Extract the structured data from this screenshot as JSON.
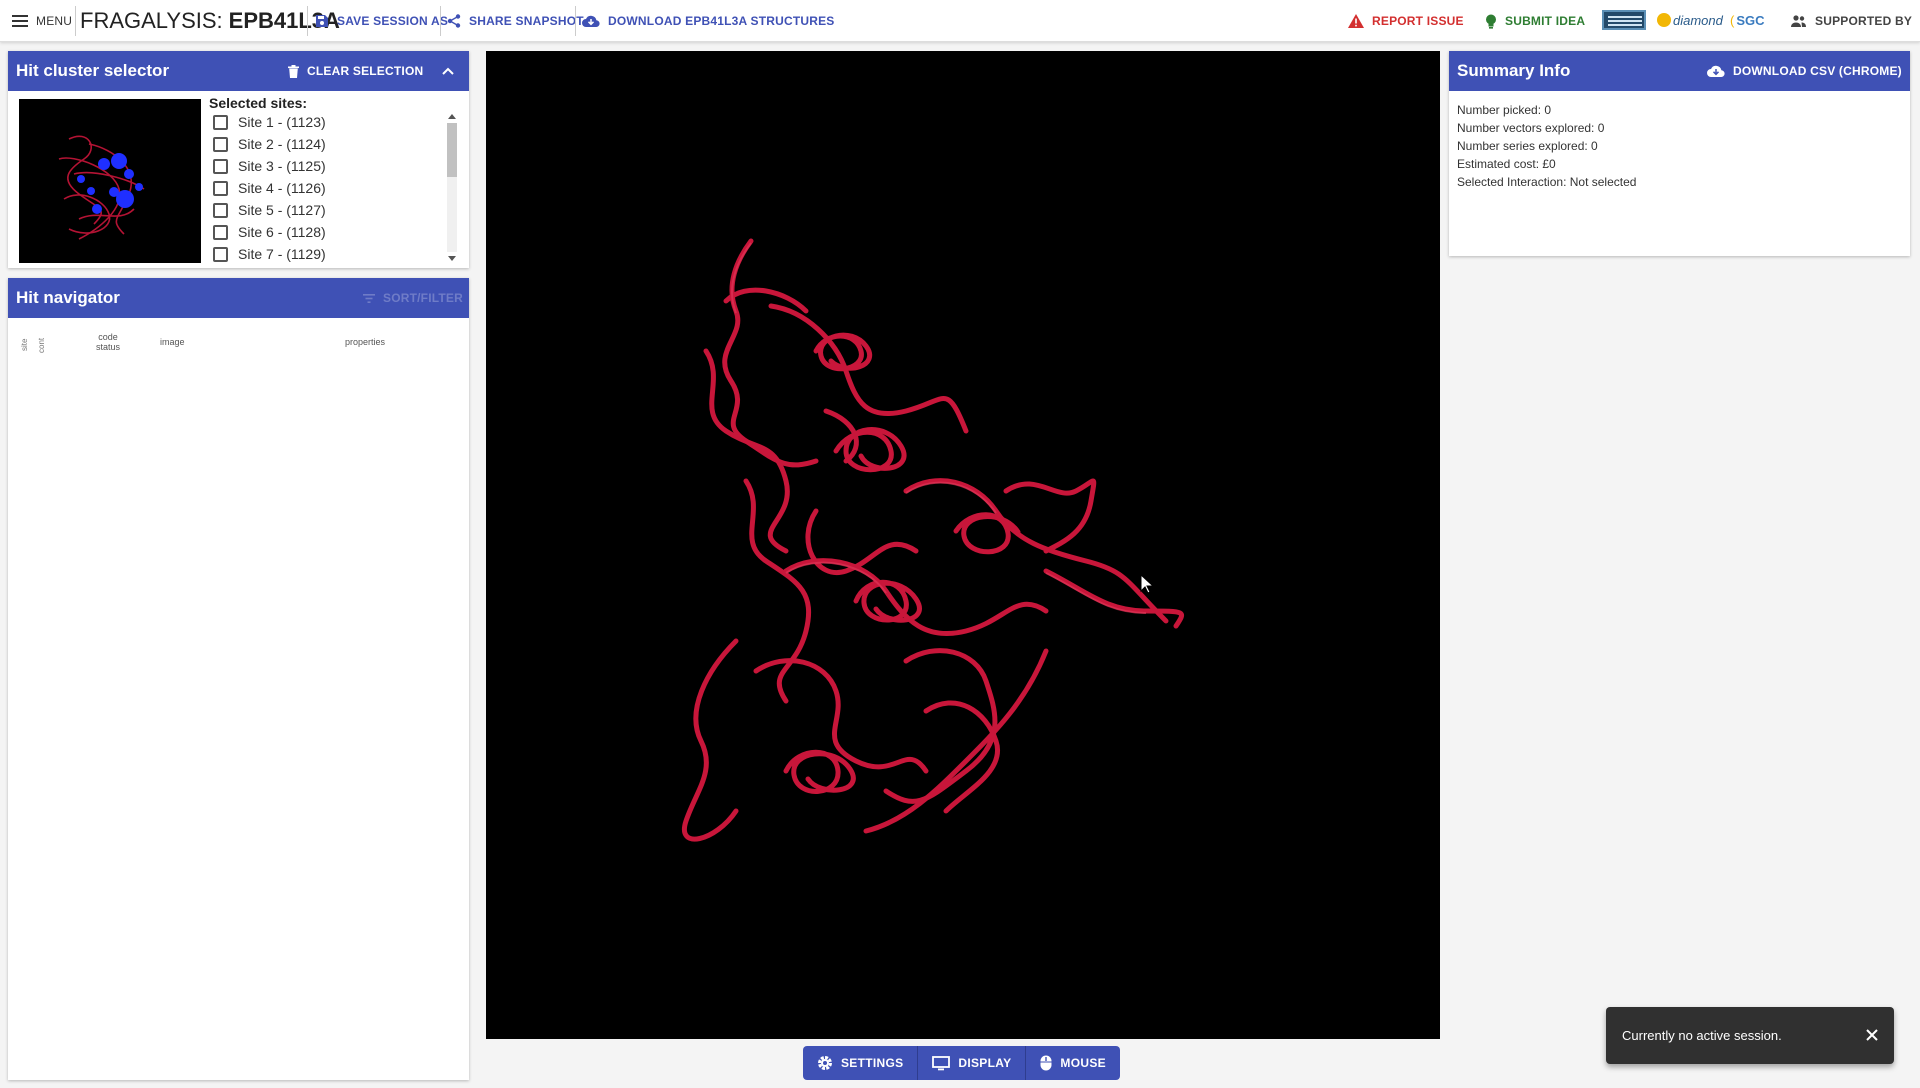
{
  "topbar": {
    "menu_label": "MENU",
    "app_name": "FRAGALYSIS:",
    "target_name": "EPB41L3A",
    "save_session_label": "SAVE SESSION AS",
    "share_snapshot_label": "SHARE SNAPSHOT",
    "download_label": "DOWNLOAD EPB41L3A STRUCTURES",
    "report_issue_label": "REPORT ISSUE",
    "submit_idea_label": "SUBMIT IDEA",
    "logo_diamond": "diamond",
    "logo_sgc": "SGC",
    "supported_by_label": "SUPPORTED BY"
  },
  "hit_cluster_selector": {
    "title": "Hit cluster selector",
    "clear_selection_label": "CLEAR SELECTION",
    "selected_sites_label": "Selected sites:",
    "sites": [
      {
        "label": "Site 1 - (1123)"
      },
      {
        "label": "Site 2 - (1124)"
      },
      {
        "label": "Site 3 - (1125)"
      },
      {
        "label": "Site 4 - (1126)"
      },
      {
        "label": "Site 5 - (1127)"
      },
      {
        "label": "Site 6 - (1128)"
      },
      {
        "label": "Site 7 - (1129)"
      }
    ]
  },
  "hit_navigator": {
    "title": "Hit navigator",
    "sort_filter_label": "SORT/FILTER",
    "columns": {
      "site": "site",
      "cont": "cont",
      "code": "code",
      "status": "status",
      "image": "image",
      "properties": "properties"
    }
  },
  "viewer_controls": {
    "settings_label": "SETTINGS",
    "display_label": "DISPLAY",
    "mouse_label": "MOUSE"
  },
  "summary": {
    "title": "Summary Info",
    "download_csv_label": "DOWNLOAD CSV (CHROME)",
    "lines": [
      "Number picked: 0",
      "Number vectors explored: 0",
      "Number series explored: 0",
      "Estimated cost: £0",
      "Selected Interaction: Not selected"
    ]
  },
  "toast": {
    "message": "Currently no active session."
  },
  "colors": {
    "primary": "#3f51b5",
    "protein": "#c8163a",
    "viewer_bg": "#000000",
    "error": "#d32f2f",
    "success": "#2e7d32"
  }
}
